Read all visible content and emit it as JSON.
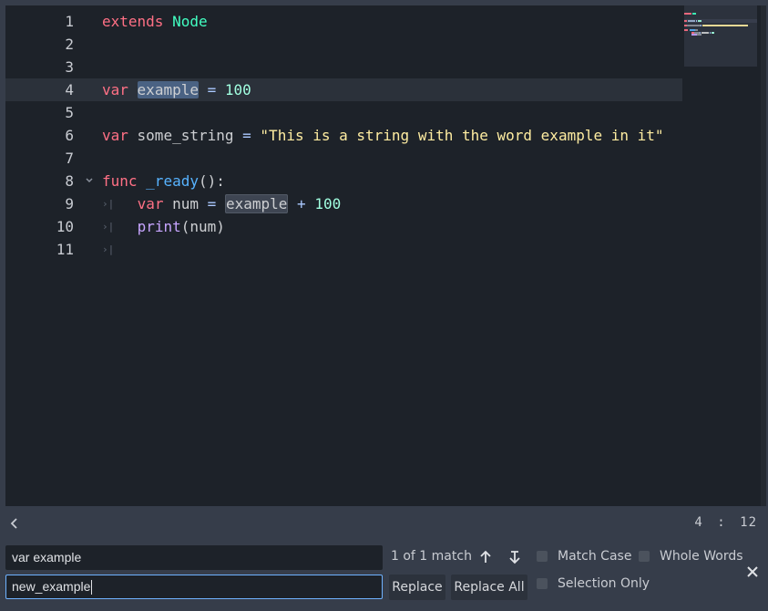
{
  "editor": {
    "current_line": 4,
    "lines": [
      {
        "n": "1",
        "tokens": [
          [
            "kw",
            "extends"
          ],
          [
            "p",
            " "
          ],
          [
            "type",
            "Node"
          ]
        ]
      },
      {
        "n": "2",
        "tokens": []
      },
      {
        "n": "3",
        "tokens": []
      },
      {
        "n": "4",
        "tokens": [
          [
            "kw",
            "var"
          ],
          [
            "p",
            " "
          ],
          [
            "sel",
            "example"
          ],
          [
            "p",
            " "
          ],
          [
            "op",
            "="
          ],
          [
            "p",
            " "
          ],
          [
            "num",
            "100"
          ]
        ]
      },
      {
        "n": "5",
        "tokens": []
      },
      {
        "n": "6",
        "tokens": [
          [
            "kw",
            "var"
          ],
          [
            "p",
            " some_string "
          ],
          [
            "op",
            "="
          ],
          [
            "p",
            " "
          ],
          [
            "str",
            "\"This is a string with the word example in it\""
          ]
        ]
      },
      {
        "n": "7",
        "tokens": []
      },
      {
        "n": "8",
        "fold": true,
        "tokens": [
          [
            "kw",
            "func"
          ],
          [
            "p",
            " "
          ],
          [
            "fn",
            "_ready"
          ],
          [
            "p",
            "():"
          ]
        ]
      },
      {
        "n": "9",
        "indent": true,
        "tokens": [
          [
            "kw",
            "var"
          ],
          [
            "p",
            " num "
          ],
          [
            "op",
            "="
          ],
          [
            "p",
            " "
          ],
          [
            "hl",
            "example"
          ],
          [
            "p",
            " "
          ],
          [
            "op",
            "+"
          ],
          [
            "p",
            " "
          ],
          [
            "num",
            "100"
          ]
        ]
      },
      {
        "n": "10",
        "indent": true,
        "tokens": [
          [
            "bi",
            "print"
          ],
          [
            "p",
            "(num)"
          ]
        ]
      },
      {
        "n": "11",
        "indent": true,
        "tokens": []
      }
    ]
  },
  "status": {
    "cursor_line": "4",
    "separator": ":",
    "cursor_column": "12"
  },
  "find_bar": {
    "find_value": "var example",
    "replace_value": "new_example",
    "match_count": "1 of 1 match",
    "replace_label": "Replace",
    "replace_all_label": "Replace All",
    "match_case_label": "Match Case",
    "whole_words_label": "Whole Words",
    "selection_only_label": "Selection Only",
    "match_case_checked": false,
    "whole_words_checked": false,
    "selection_only_checked": false
  },
  "colors": {
    "keyword": "#ff7085",
    "type": "#42ffc2",
    "number": "#a1ffe0",
    "string": "#ffeda1",
    "function": "#57b3ff",
    "selection": "#4a6283",
    "focus_border": "#6fb2ff"
  },
  "icons": [
    "chevron-left-icon",
    "previous-match-icon",
    "next-match-icon",
    "close-icon",
    "fold-arrow-icon",
    "tab-indicator-icon"
  ]
}
